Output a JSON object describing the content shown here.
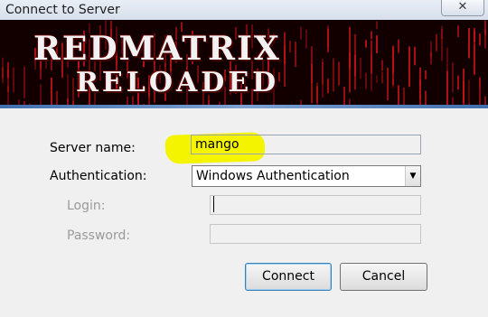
{
  "window": {
    "title": "Connect to Server",
    "close_glyph": "✕"
  },
  "banner": {
    "line1": "REDMATRIX",
    "line2": "RELOADED",
    "accent": "#c2141a"
  },
  "form": {
    "server_name_label": "Server name:",
    "server_name_value": "mango",
    "authentication_label": "Authentication:",
    "authentication_value": "Windows Authentication",
    "login_label": "Login:",
    "login_value": "",
    "password_label": "Password:",
    "password_value": ""
  },
  "buttons": {
    "connect": "Connect",
    "cancel": "Cancel"
  },
  "icons": {
    "dropdown": "dropdown-arrow-icon",
    "close": "close-icon"
  }
}
